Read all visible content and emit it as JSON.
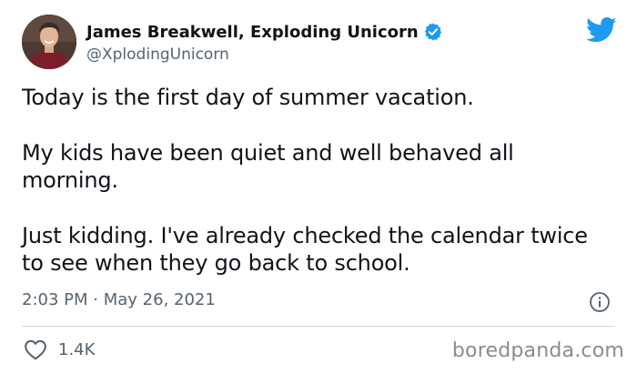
{
  "author": {
    "display_name": "James Breakwell, Exploding Unicorn",
    "handle": "@XplodingUnicorn",
    "verified_icon": "verified-badge-icon",
    "avatar_icon": "profile-avatar"
  },
  "tweet": {
    "paragraphs": [
      "Today is the first day of summer vacation.",
      "My kids have been quiet and well behaved all morning.",
      "Just kidding. I've already checked the calendar twice to see when they go back to school."
    ],
    "time": "2:03 PM",
    "separator": "·",
    "date": "May 26, 2021"
  },
  "stats": {
    "likes": "1.4K"
  },
  "icons": {
    "brand": "twitter-bird-icon",
    "info": "info-icon",
    "like": "heart-icon"
  },
  "watermark": "boredpanda.com",
  "colors": {
    "twitter_blue": "#1d9bf0",
    "secondary_text": "#536471",
    "primary_text": "#0f1419",
    "divider": "#cfd9de"
  }
}
